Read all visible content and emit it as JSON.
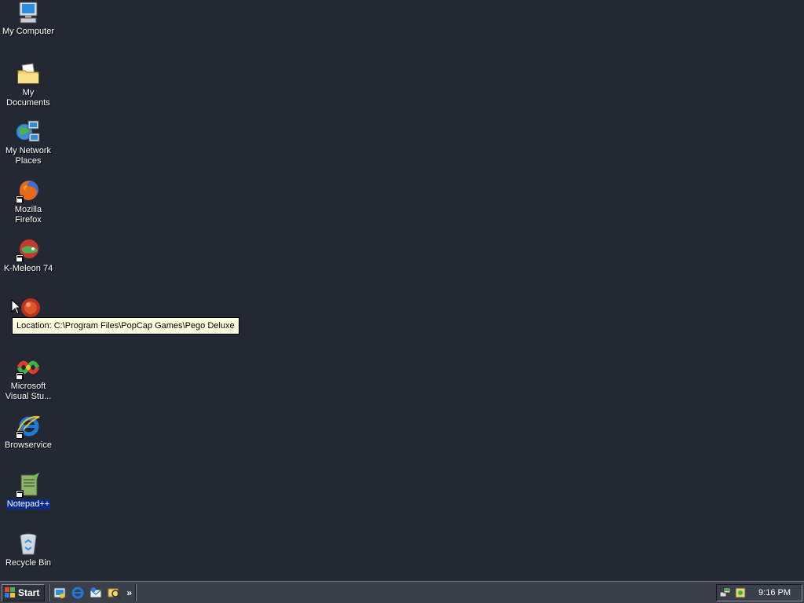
{
  "desktop": {
    "icons": [
      {
        "label": "My Computer",
        "icon": "my-computer-icon"
      },
      {
        "label": "My Documents",
        "icon": "my-documents-icon"
      },
      {
        "label": "My Network Places",
        "icon": "network-places-icon"
      },
      {
        "label": "Mozilla Firefox",
        "icon": "firefox-icon"
      },
      {
        "label": "K-Meleon 74",
        "icon": "k-meleon-icon"
      },
      {
        "label": "",
        "icon": "pego-icon"
      },
      {
        "label": "Microsoft Visual Stu...",
        "icon": "visual-studio-icon"
      },
      {
        "label": "Browservice",
        "icon": "ie-icon"
      },
      {
        "label": "Notepad++",
        "icon": "notepadpp-icon",
        "selected": true
      },
      {
        "label": "Recycle Bin",
        "icon": "recycle-bin-icon"
      }
    ],
    "tooltip": "Location: C:\\Program Files\\PopCap Games\\Pego Deluxe"
  },
  "taskbar": {
    "start_label": "Start",
    "quicklaunch": [
      "show-desktop-icon",
      "ie-icon",
      "outlook-icon",
      "search-icon"
    ],
    "more_label": "»",
    "tray_icons": [
      "network-icon",
      "security-icon"
    ],
    "clock": "9:16 PM"
  },
  "colors": {
    "desktop_background": "#232833",
    "taskbar": "#3a3f4a",
    "tooltip_background": "#ffffe1",
    "selection": "#0b2a8a"
  }
}
